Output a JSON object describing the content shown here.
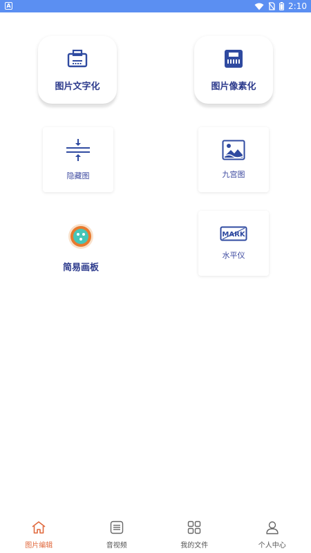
{
  "status_bar": {
    "app_badge": "A",
    "time": "2:10"
  },
  "tools": [
    {
      "label": "图片文字化",
      "icon": "text-scan-icon"
    },
    {
      "label": "图片像素化",
      "icon": "pixel-icon"
    },
    {
      "label": "隐藏图",
      "icon": "compress-icon"
    },
    {
      "label": "九宫图",
      "icon": "image-icon"
    },
    {
      "label": "简易画板",
      "icon": "palette-icon"
    },
    {
      "label": "水平仪",
      "icon": "mark-icon",
      "icon_text": "MARK"
    }
  ],
  "tabbar": {
    "items": [
      {
        "label": "图片编辑",
        "icon": "home-icon",
        "active": true
      },
      {
        "label": "音视频",
        "icon": "list-icon"
      },
      {
        "label": "我的文件",
        "icon": "grid-icon"
      },
      {
        "label": "个人中心",
        "icon": "user-icon"
      }
    ]
  },
  "colors": {
    "status_bar": "#5b8ff2",
    "accent": "#e0683c",
    "icon_blue": "#2f4aa0"
  }
}
